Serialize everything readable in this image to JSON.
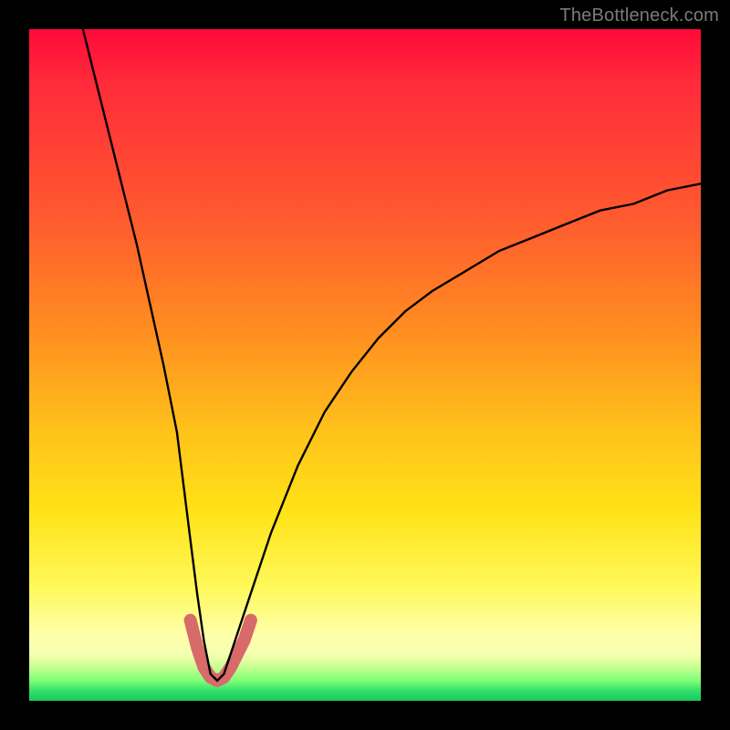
{
  "watermark": "TheBottleneck.com",
  "colors": {
    "background_frame": "#000000",
    "curve": "#000000",
    "highlight": "#d86a6a",
    "gradient_top": "#ff0a3a",
    "gradient_bottom": "#18c85e"
  },
  "chart_data": {
    "type": "line",
    "title": "",
    "xlabel": "",
    "ylabel": "",
    "xlim": [
      0,
      100
    ],
    "ylim": [
      0,
      100
    ],
    "grid": false,
    "notes": "V-shaped bottleneck curve over vertical red→yellow→green gradient. Minimum near x≈27, y≈3. Left branch steep from (8,100) down to trough; right branch rises concavely toward (100,~77). Pink/salmon highlight overlays the trough segment roughly x∈[24,33], y∈[3,12].",
    "series": [
      {
        "name": "bottleneck-curve",
        "x": [
          8,
          10,
          12,
          14,
          16,
          18,
          20,
          22,
          24,
          25,
          26,
          27,
          28,
          29,
          30,
          32,
          34,
          36,
          38,
          40,
          44,
          48,
          52,
          56,
          60,
          65,
          70,
          75,
          80,
          85,
          90,
          95,
          100
        ],
        "y": [
          100,
          92,
          84,
          76,
          68,
          59,
          50,
          40,
          24,
          16,
          9,
          4,
          3,
          4,
          7,
          13,
          19,
          25,
          30,
          35,
          43,
          49,
          54,
          58,
          61,
          64,
          67,
          69,
          71,
          73,
          74,
          76,
          77
        ]
      }
    ],
    "highlight_segment": {
      "name": "trough-highlight",
      "x": [
        24,
        25,
        26,
        27,
        28,
        29,
        30,
        31,
        32,
        33
      ],
      "y": [
        12,
        8,
        5,
        3.5,
        3,
        3.5,
        5,
        7,
        9,
        12
      ]
    },
    "background": {
      "type": "vertical-gradient",
      "stops": [
        {
          "pos": 0.0,
          "color": "#ff0a3a"
        },
        {
          "pos": 0.28,
          "color": "#ff5a2f"
        },
        {
          "pos": 0.6,
          "color": "#ffc21a"
        },
        {
          "pos": 0.83,
          "color": "#fff85a"
        },
        {
          "pos": 0.93,
          "color": "#f6ffb0"
        },
        {
          "pos": 0.97,
          "color": "#7dff78"
        },
        {
          "pos": 1.0,
          "color": "#18c85e"
        }
      ]
    }
  }
}
